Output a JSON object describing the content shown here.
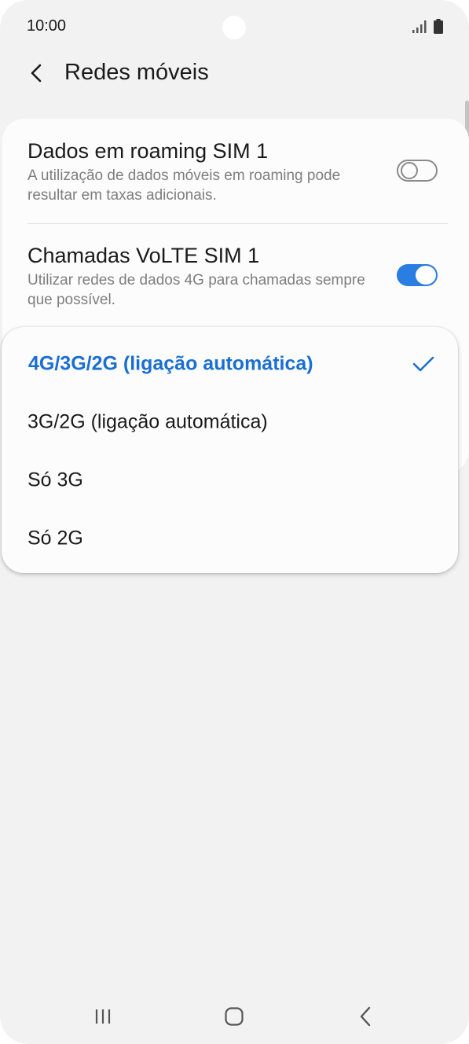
{
  "status_bar": {
    "time": "10:00",
    "signal_icon": "signal-icon",
    "battery_icon": "battery-icon"
  },
  "header": {
    "back_icon": "chevron-left-icon",
    "title": "Redes móveis"
  },
  "settings": [
    {
      "title": "Dados em roaming SIM 1",
      "description": "A utilização de dados móveis em roaming pode resultar em taxas adicionais.",
      "enabled": false
    },
    {
      "title": "Chamadas VoLTE SIM 1",
      "description": "Utilizar redes de dados 4G para chamadas sempre que possível.",
      "enabled": true
    }
  ],
  "network_menu": {
    "options": [
      {
        "label": "4G/3G/2G (ligação automática)",
        "selected": true
      },
      {
        "label": "3G/2G (ligação automática)",
        "selected": false
      },
      {
        "label": "Só 3G",
        "selected": false
      },
      {
        "label": "Só 2G",
        "selected": false
      }
    ],
    "check_icon": "checkmark-icon"
  },
  "nav_bar": {
    "recents_icon": "recents-icon",
    "home_icon": "home-icon",
    "back_icon": "back-icon"
  },
  "colors": {
    "accent": "#1a6fd2",
    "toggle_on": "#2a7de1",
    "background": "#f2f2f2",
    "card": "#fcfcfc"
  }
}
